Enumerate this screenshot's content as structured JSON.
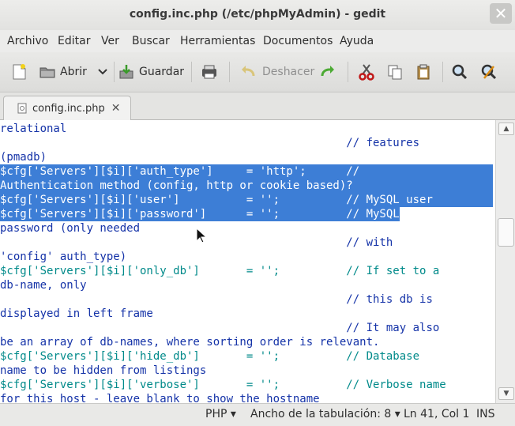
{
  "window": {
    "title": "config.inc.php (/etc/phpMyAdmin) - gedit"
  },
  "menu": [
    "Archivo",
    "Editar",
    "Ver",
    "Buscar",
    "Herramientas",
    "Documentos",
    "Ayuda"
  ],
  "toolbar": {
    "open_label": "Abrir",
    "save_label": "Guardar",
    "undo_label": "Deshacer"
  },
  "tab": {
    "label": "config.inc.php"
  },
  "editor": {
    "lines": [
      "relational",
      "                                                    // features",
      "(pmadb)",
      "$cfg['Servers'][$i]['auth_type']     = 'http';      //",
      "Authentication method (config, http or cookie based)?",
      "$cfg['Servers'][$i]['user']          = '';          // MySQL user",
      "$cfg['Servers'][$i]['password']      = '';          // MySQL",
      "password (only needed",
      "                                                    // with",
      "'config' auth_type)",
      "$cfg['Servers'][$i]['only_db']       = '';          // If set to a",
      "db-name, only",
      "                                                    // this db is",
      "displayed in left frame",
      "                                                    // It may also",
      "be an array of db-names, where sorting order is relevant.",
      "$cfg['Servers'][$i]['hide_db']       = '';          // Database",
      "name to be hidden from listings",
      "$cfg['Servers'][$i]['verbose']       = '';          // Verbose name",
      "for this host - leave blank to show the hostname"
    ]
  },
  "status": {
    "language": "PHP",
    "tab_width": "Ancho de la tabulación: 8",
    "position": "Ln 41, Col 1",
    "mode": "INS"
  }
}
